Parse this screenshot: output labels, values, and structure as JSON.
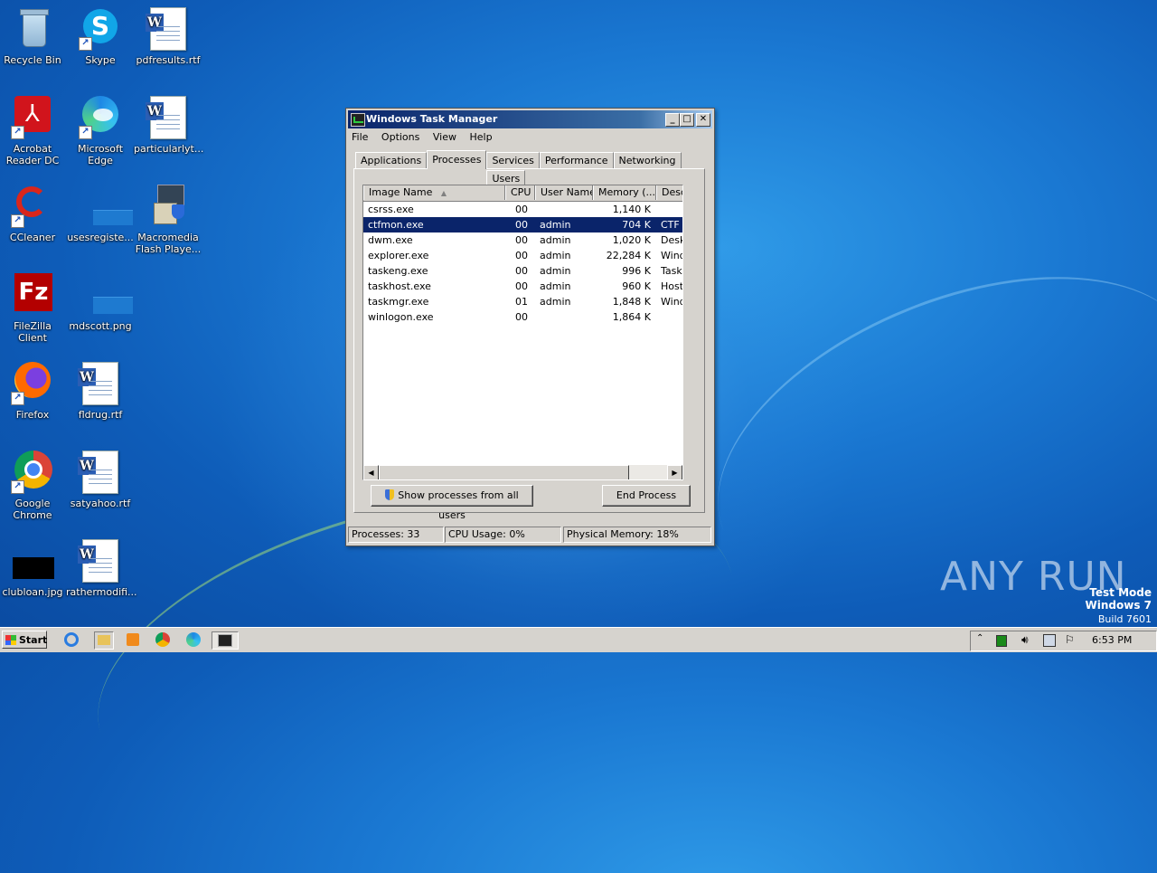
{
  "desktop": {
    "icons": [
      {
        "label": "Recycle Bin"
      },
      {
        "label": "Skype"
      },
      {
        "label": "pdfresults.rtf"
      },
      {
        "label": "Acrobat Reader DC"
      },
      {
        "label": "Microsoft Edge"
      },
      {
        "label": "particularlyt..."
      },
      {
        "label": "CCleaner"
      },
      {
        "label": "usesregiste..."
      },
      {
        "label": "Macromedia Flash Playe..."
      },
      {
        "label": "FileZilla Client"
      },
      {
        "label": "mdscott.png"
      },
      {
        "label": "Firefox"
      },
      {
        "label": "fldrug.rtf"
      },
      {
        "label": "Google Chrome"
      },
      {
        "label": "satyahoo.rtf"
      },
      {
        "label": "clubloan.jpg"
      },
      {
        "label": "rathermodifi..."
      }
    ]
  },
  "window": {
    "title": "Windows Task Manager",
    "menu": [
      "File",
      "Options",
      "View",
      "Help"
    ],
    "tabs": [
      "Applications",
      "Processes",
      "Services",
      "Performance",
      "Networking",
      "Users"
    ],
    "active_tab": "Processes",
    "columns": [
      "Image Name",
      "CPU",
      "User Name",
      "Memory (...",
      "Desc"
    ],
    "processes": [
      {
        "name": "csrss.exe",
        "cpu": "00",
        "user": "",
        "memory": "1,140 K",
        "desc": ""
      },
      {
        "name": "ctfmon.exe",
        "cpu": "00",
        "user": "admin",
        "memory": "704 K",
        "desc": "CTF L"
      },
      {
        "name": "dwm.exe",
        "cpu": "00",
        "user": "admin",
        "memory": "1,020 K",
        "desc": "Deskt"
      },
      {
        "name": "explorer.exe",
        "cpu": "00",
        "user": "admin",
        "memory": "22,284 K",
        "desc": "Wind"
      },
      {
        "name": "taskeng.exe",
        "cpu": "00",
        "user": "admin",
        "memory": "996 K",
        "desc": "Task"
      },
      {
        "name": "taskhost.exe",
        "cpu": "00",
        "user": "admin",
        "memory": "960 K",
        "desc": "Host"
      },
      {
        "name": "taskmgr.exe",
        "cpu": "01",
        "user": "admin",
        "memory": "1,848 K",
        "desc": "Wind"
      },
      {
        "name": "winlogon.exe",
        "cpu": "00",
        "user": "",
        "memory": "1,864 K",
        "desc": ""
      }
    ],
    "selected_row": "ctfmon.exe",
    "show_all_button": "Show processes from all users",
    "end_process_button": "End Process",
    "status": {
      "processes": "Processes: 33",
      "cpu": "CPU Usage: 0%",
      "memory": "Physical Memory: 18%"
    }
  },
  "taskbar": {
    "start_label": "Start",
    "clock": "6:53 PM"
  },
  "watermark": {
    "line1": "Test Mode",
    "line2": "Windows 7",
    "line3": "Build 7601",
    "brand": "ANY RUN"
  }
}
